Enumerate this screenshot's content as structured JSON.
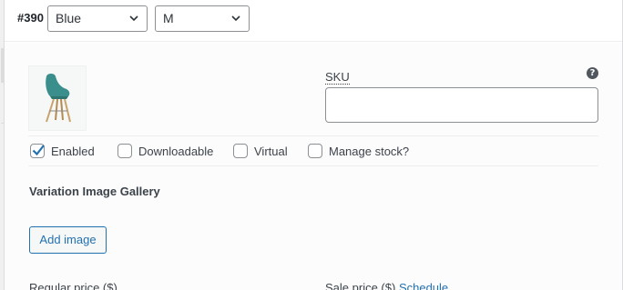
{
  "variation": {
    "id_label": "#390",
    "color_select": {
      "value": "Blue"
    },
    "size_select": {
      "value": "M"
    }
  },
  "sku": {
    "label": "SKU",
    "help_icon": "?",
    "value": ""
  },
  "options": [
    {
      "label": "Enabled",
      "checked": true
    },
    {
      "label": "Downloadable",
      "checked": false
    },
    {
      "label": "Virtual",
      "checked": false
    },
    {
      "label": "Manage stock?",
      "checked": false
    }
  ],
  "gallery": {
    "title": "Variation Image Gallery",
    "add_button": "Add image"
  },
  "pricing": {
    "regular_label": "Regular price ($)",
    "sale_label": "Sale price ($)",
    "schedule_link": "Schedule"
  },
  "colors": {
    "accent": "#2271b1",
    "border": "#8c8f94",
    "text": "#3c434a"
  }
}
